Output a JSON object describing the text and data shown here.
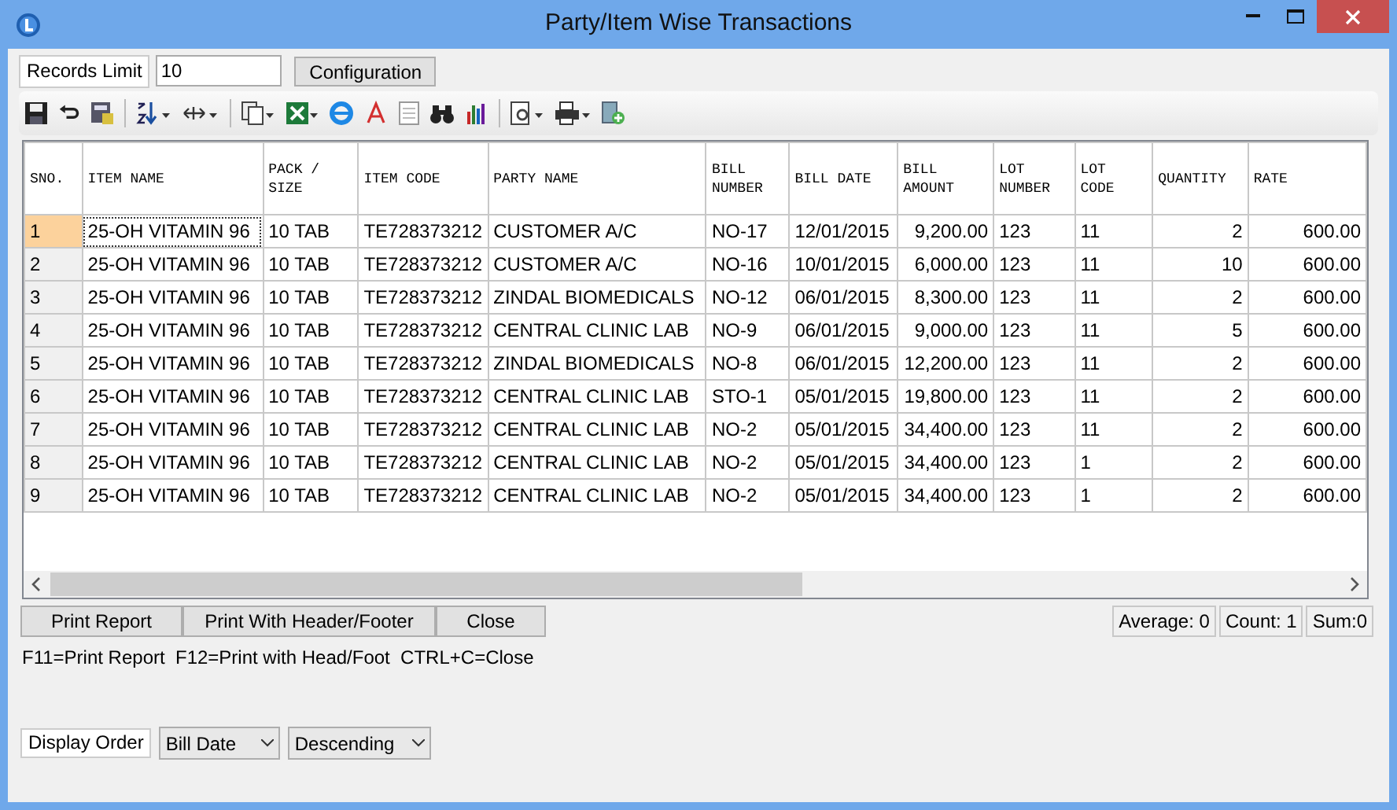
{
  "window": {
    "title": "Party/Item Wise Transactions"
  },
  "records_limit": {
    "label": "Records Limit",
    "value": "10"
  },
  "configuration_button": "Configuration",
  "table": {
    "columns": [
      {
        "label": "SNO."
      },
      {
        "label": "ITEM NAME"
      },
      {
        "label": "PACK / SIZE"
      },
      {
        "label": "ITEM CODE"
      },
      {
        "label": "PARTY NAME"
      },
      {
        "label": "BILL NUMBER"
      },
      {
        "label": "BILL DATE"
      },
      {
        "label": "BILL AMOUNT"
      },
      {
        "label": "LOT NUMBER"
      },
      {
        "label": "LOT CODE"
      },
      {
        "label": "QUANTITY"
      },
      {
        "label": "RATE"
      }
    ],
    "rows": [
      {
        "selected": true,
        "cells": [
          "1",
          "25-OH VITAMIN 96",
          "10 TAB",
          "TE728373212",
          "CUSTOMER A/C",
          "NO-17",
          "12/01/2015",
          "9,200.00",
          "123",
          "11",
          "2",
          "600.00"
        ]
      },
      {
        "selected": false,
        "cells": [
          "2",
          "25-OH VITAMIN 96",
          "10 TAB",
          "TE728373212",
          "CUSTOMER A/C",
          "NO-16",
          "10/01/2015",
          "6,000.00",
          "123",
          "11",
          "10",
          "600.00"
        ]
      },
      {
        "selected": false,
        "cells": [
          "3",
          "25-OH VITAMIN 96",
          "10 TAB",
          "TE728373212",
          "ZINDAL BIOMEDICALS",
          "NO-12",
          "06/01/2015",
          "8,300.00",
          "123",
          "11",
          "2",
          "600.00"
        ]
      },
      {
        "selected": false,
        "cells": [
          "4",
          "25-OH VITAMIN 96",
          "10 TAB",
          "TE728373212",
          "CENTRAL CLINIC LAB",
          "NO-9",
          "06/01/2015",
          "9,000.00",
          "123",
          "11",
          "5",
          "600.00"
        ]
      },
      {
        "selected": false,
        "cells": [
          "5",
          "25-OH VITAMIN 96",
          "10 TAB",
          "TE728373212",
          "ZINDAL BIOMEDICALS",
          "NO-8",
          "06/01/2015",
          "12,200.00",
          "123",
          "11",
          "2",
          "600.00"
        ]
      },
      {
        "selected": false,
        "cells": [
          "6",
          "25-OH VITAMIN 96",
          "10 TAB",
          "TE728373212",
          "CENTRAL CLINIC LAB",
          "STO-1",
          "05/01/2015",
          "19,800.00",
          "123",
          "11",
          "2",
          "600.00"
        ]
      },
      {
        "selected": false,
        "cells": [
          "7",
          "25-OH VITAMIN 96",
          "10 TAB",
          "TE728373212",
          "CENTRAL CLINIC LAB",
          "NO-2",
          "05/01/2015",
          "34,400.00",
          "123",
          "11",
          "2",
          "600.00"
        ]
      },
      {
        "selected": false,
        "cells": [
          "8",
          "25-OH VITAMIN 96",
          "10 TAB",
          "TE728373212",
          "CENTRAL CLINIC LAB",
          "NO-2",
          "05/01/2015",
          "34,400.00",
          "123",
          "1",
          "2",
          "600.00"
        ]
      },
      {
        "selected": false,
        "cells": [
          "9",
          "25-OH VITAMIN 96",
          "10 TAB",
          "TE728373212",
          "CENTRAL CLINIC LAB",
          "NO-2",
          "05/01/2015",
          "34,400.00",
          "123",
          "1",
          "2",
          "600.00"
        ]
      }
    ]
  },
  "buttons": [
    "Print Report",
    "Print With Header/Footer",
    "Close"
  ],
  "summary": [
    "Average: 0",
    "Count: 1",
    "Sum:0"
  ],
  "shortcuts": "F11=Print Report  F12=Print with Head/Foot  CTRL+C=Close",
  "display_order": {
    "label": "Display Order",
    "field": "Bill Date",
    "direction": "Descending"
  }
}
